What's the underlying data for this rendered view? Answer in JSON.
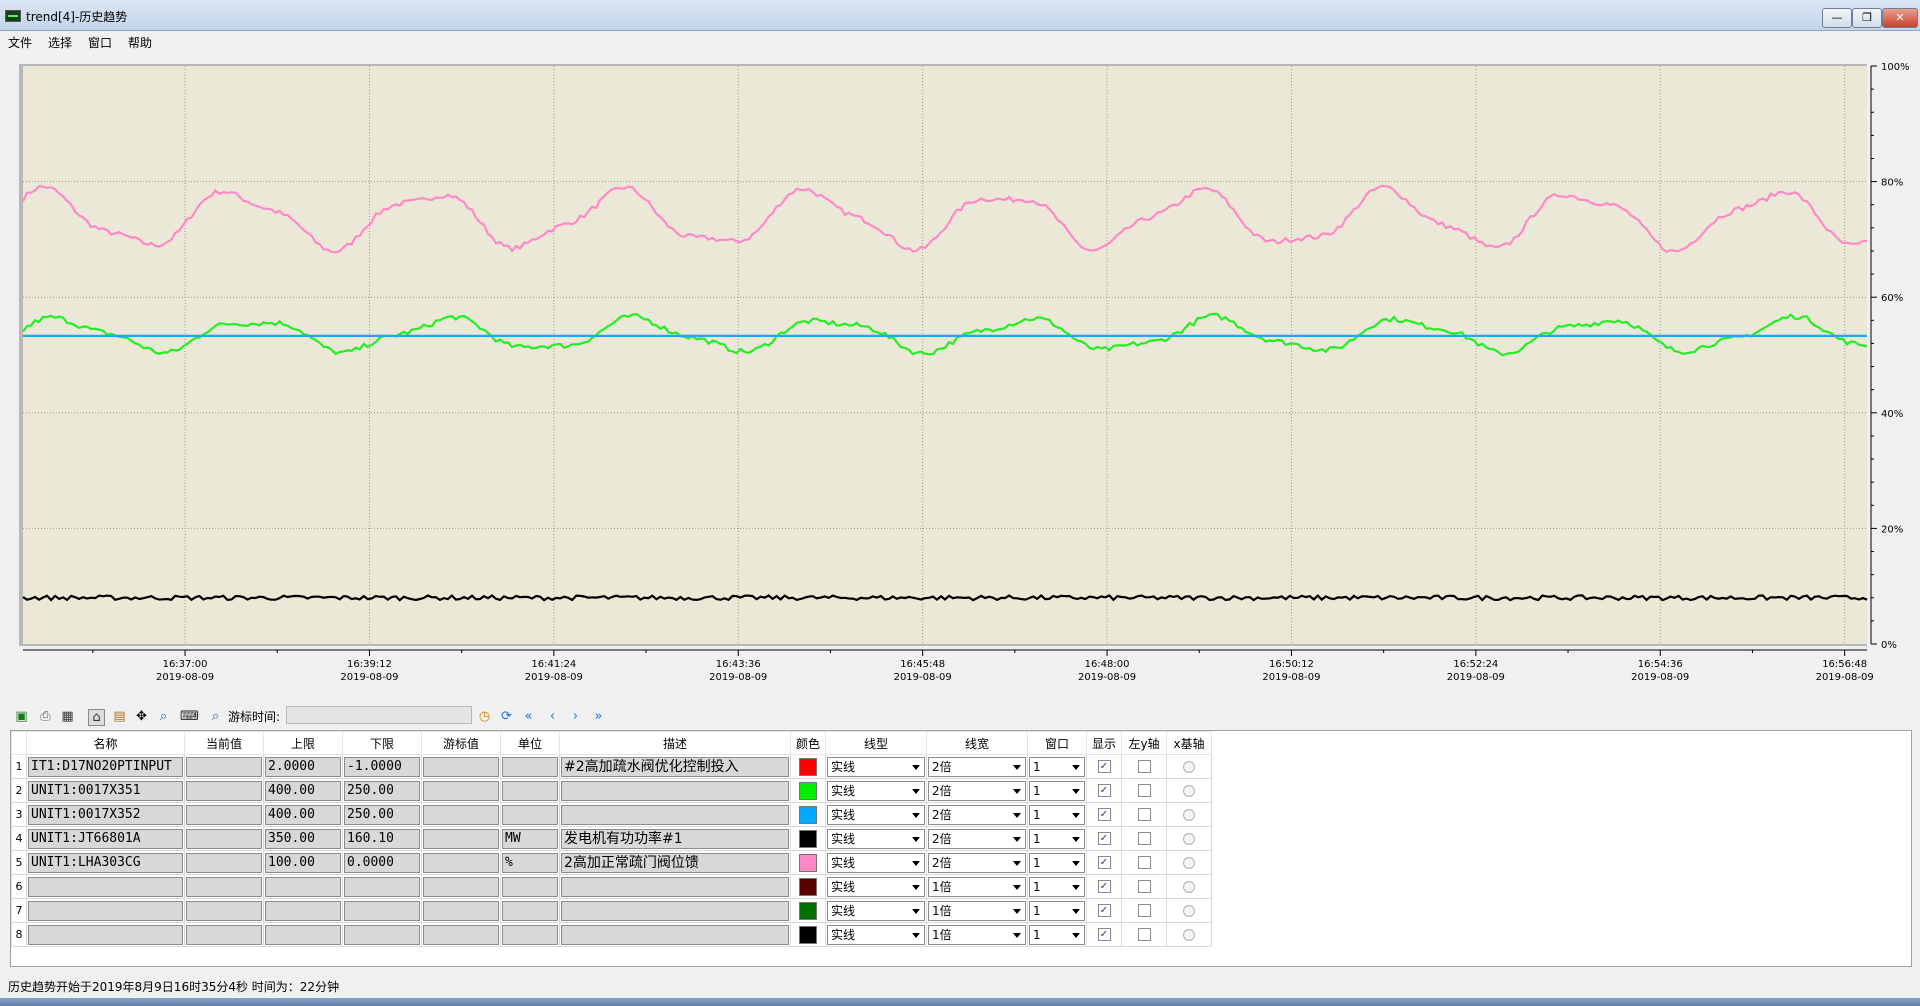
{
  "window": {
    "title": "trend[4]-历史趋势",
    "min": "—",
    "max": "❐",
    "close": "✕"
  },
  "menu": [
    "文件",
    "选择",
    "窗口",
    "帮助"
  ],
  "chart_data": {
    "type": "line",
    "y_ticks": [
      "100%",
      "80%",
      "60%",
      "40%",
      "20%",
      "0%"
    ],
    "x_ticks": [
      {
        "time": "16:37:00",
        "date": "2019-08-09"
      },
      {
        "time": "16:39:12",
        "date": "2019-08-09"
      },
      {
        "time": "16:41:24",
        "date": "2019-08-09"
      },
      {
        "time": "16:43:36",
        "date": "2019-08-09"
      },
      {
        "time": "16:45:48",
        "date": "2019-08-09"
      },
      {
        "time": "16:48:00",
        "date": "2019-08-09"
      },
      {
        "time": "16:50:12",
        "date": "2019-08-09"
      },
      {
        "time": "16:52:24",
        "date": "2019-08-09"
      },
      {
        "time": "16:54:36",
        "date": "2019-08-09"
      },
      {
        "time": "16:56:48",
        "date": "2019-08-09"
      }
    ],
    "x_range": [
      "16:35:04",
      "16:57:04"
    ],
    "y_range_percent": [
      0,
      100
    ],
    "grid": true,
    "background": "#ece8d8",
    "series": [
      {
        "color": "#ff88c8",
        "kind": "wave",
        "base_percent": 73.5,
        "amplitude_percent": 4.5,
        "periods": 9.6,
        "phase": 0.9
      },
      {
        "color": "#22ee22",
        "kind": "wave",
        "base_percent": 53.5,
        "amplitude_percent": 2.6,
        "periods": 9.6,
        "phase": 0.3
      },
      {
        "color": "#1ea8f0",
        "kind": "flat",
        "base_percent": 53.3
      },
      {
        "color": "#000000",
        "kind": "flat_noisy",
        "base_percent": 8.0,
        "noise_percent": 0.4
      }
    ]
  },
  "toolbar": {
    "cursor_label": "游标时间:"
  },
  "grid": {
    "headers": [
      "",
      "名称",
      "当前值",
      "上限",
      "下限",
      "游标值",
      "单位",
      "描述",
      "颜色",
      "线型",
      "线宽",
      "窗口",
      "显示",
      "左y轴",
      "x基轴"
    ],
    "rows": [
      {
        "n": "1",
        "name": "IT1:D17NO20PTINPUT",
        "cur": "",
        "hi": "2.0000",
        "lo": "-1.0000",
        "cursor": "",
        "unit": "",
        "desc": "#2高加疏水阀优化控制投入",
        "color": "#ff0000",
        "style": "实线",
        "width": "2倍",
        "win": "1",
        "show": "✓"
      },
      {
        "n": "2",
        "name": "UNIT1:0017X351",
        "cur": "",
        "hi": "400.00",
        "lo": "250.00",
        "cursor": "",
        "unit": "",
        "desc": "",
        "color": "#00ee00",
        "style": "实线",
        "width": "2倍",
        "win": "1",
        "show": "✓"
      },
      {
        "n": "3",
        "name": "UNIT1:0017X352",
        "cur": "",
        "hi": "400.00",
        "lo": "250.00",
        "cursor": "",
        "unit": "",
        "desc": "",
        "color": "#00a8ff",
        "style": "实线",
        "width": "2倍",
        "win": "1",
        "show": "✓"
      },
      {
        "n": "4",
        "name": "UNIT1:JT66801A",
        "cur": "",
        "hi": "350.00",
        "lo": "160.10",
        "cursor": "",
        "unit": "MW",
        "desc": "发电机有功功率#1",
        "color": "#000000",
        "style": "实线",
        "width": "2倍",
        "win": "1",
        "show": "✓"
      },
      {
        "n": "5",
        "name": "UNIT1:LHA303CG",
        "cur": "",
        "hi": "100.00",
        "lo": "0.0000",
        "cursor": "",
        "unit": "%",
        "desc": "2高加正常疏门阀位馈",
        "color": "#ff88c8",
        "style": "实线",
        "width": "2倍",
        "win": "1",
        "show": "✓"
      },
      {
        "n": "6",
        "name": "",
        "cur": "",
        "hi": "",
        "lo": "",
        "cursor": "",
        "unit": "",
        "desc": "",
        "color": "#5a0000",
        "style": "实线",
        "width": "1倍",
        "win": "1",
        "show": "✓"
      },
      {
        "n": "7",
        "name": "",
        "cur": "",
        "hi": "",
        "lo": "",
        "cursor": "",
        "unit": "",
        "desc": "",
        "color": "#007000",
        "style": "实线",
        "width": "1倍",
        "win": "1",
        "show": "✓"
      },
      {
        "n": "8",
        "name": "",
        "cur": "",
        "hi": "",
        "lo": "",
        "cursor": "",
        "unit": "",
        "desc": "",
        "color": "#000000",
        "style": "实线",
        "width": "1倍",
        "win": "1",
        "show": "✓"
      }
    ]
  },
  "status": {
    "text": "历史趋势开始于2019年8月9日16时35分4秒  时间为：22分钟"
  }
}
